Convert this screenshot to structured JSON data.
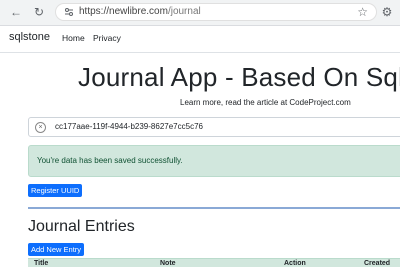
{
  "browser": {
    "url_host": "https://newlibre.com",
    "url_path": "/journal"
  },
  "navbar": {
    "brand": "sqlstone",
    "links": [
      "Home",
      "Privacy"
    ]
  },
  "main": {
    "title": "Journal App - Based On Sqls",
    "subtitle": "Learn more, read the article at CodeProject.com",
    "uuid_value": "cc177aae-119f-4944-b239-8627e7cc5c76",
    "alert_text": "You're data has been saved successfully.",
    "register_button": "Register UUID",
    "section_title": "Journal Entries",
    "add_button": "Add New Entry"
  },
  "table": {
    "columns": [
      "Title",
      "Note",
      "Action",
      "Created"
    ]
  },
  "colors": {
    "primary": "#0d6efd",
    "alert_bg": "#d1e7dd",
    "alert_text": "#0f5132"
  }
}
